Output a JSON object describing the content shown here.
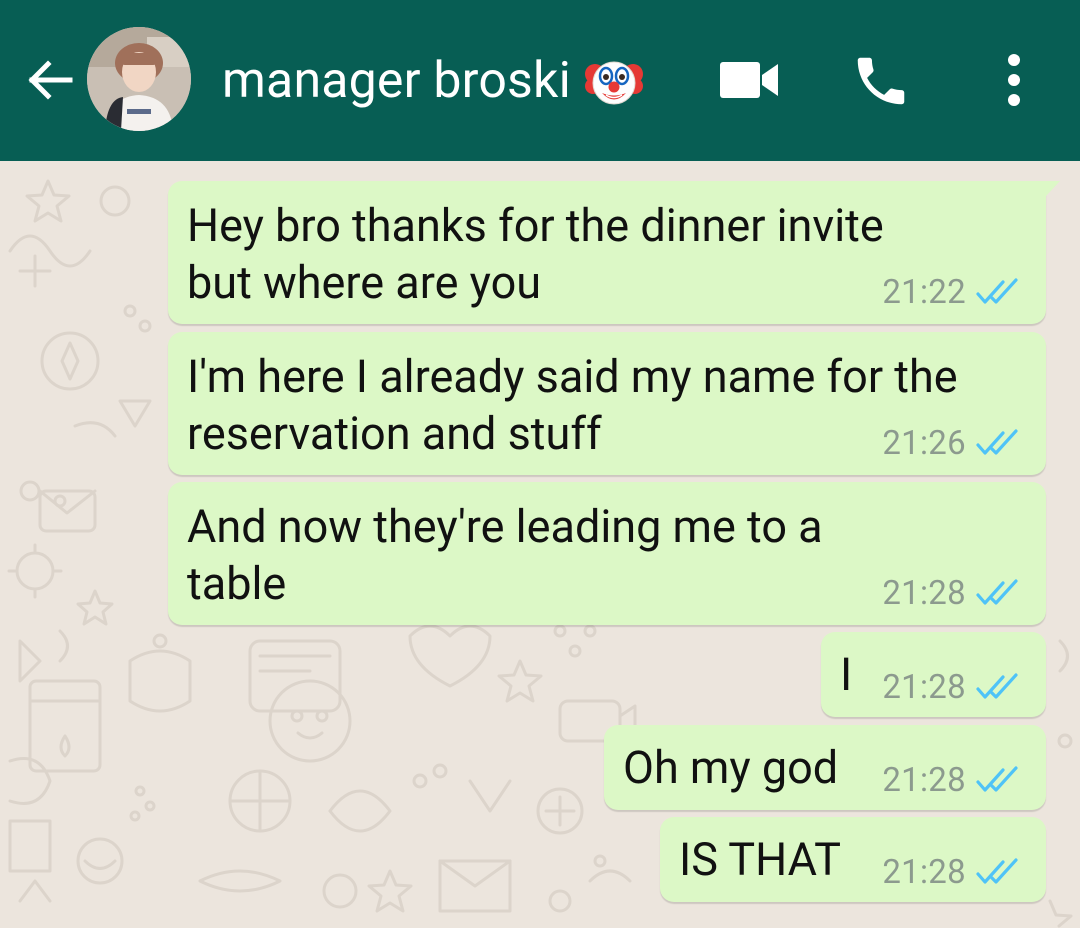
{
  "header": {
    "contact_name": "manager broski",
    "background_color": "#075e54",
    "icons": {
      "back": "arrow-left-icon",
      "avatar": "profile-photo",
      "emoji": "clown-face-emoji",
      "video": "video-camera-icon",
      "call": "phone-icon",
      "menu": "more-vertical-icon"
    }
  },
  "chat": {
    "background_color": "#ece5dd",
    "bubble_color": "#dcf8c6",
    "tick_color": "#4fc3f7",
    "messages": [
      {
        "lines": [
          "Hey bro thanks for the dinner invite",
          "but where are you"
        ],
        "time": "21:22",
        "status": "read"
      },
      {
        "lines": [
          "I'm here I already said my name for the",
          "reservation and stuff"
        ],
        "time": "21:26",
        "status": "read"
      },
      {
        "lines": [
          "And now they're leading me to a",
          "table"
        ],
        "time": "21:28",
        "status": "read"
      },
      {
        "lines": [
          "I"
        ],
        "time": "21:28",
        "status": "read"
      },
      {
        "lines": [
          "Oh my god"
        ],
        "time": "21:28",
        "status": "read"
      },
      {
        "lines": [
          "IS THAT"
        ],
        "time": "21:28",
        "status": "read"
      }
    ]
  }
}
